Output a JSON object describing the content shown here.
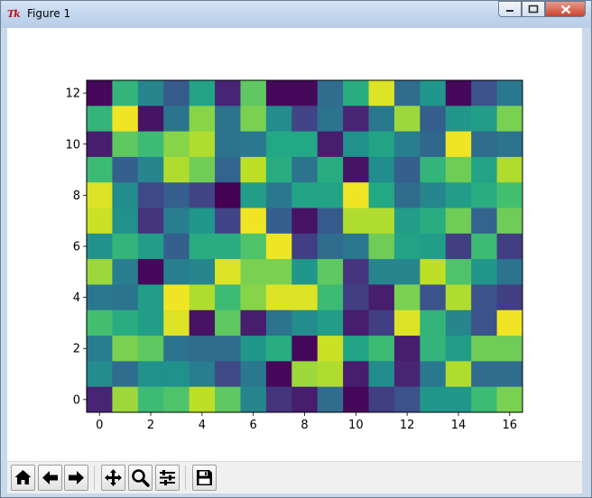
{
  "window": {
    "title": "Figure 1",
    "app_icon_text": "Tk",
    "controls": [
      "minimize",
      "maximize",
      "close"
    ]
  },
  "toolbar": {
    "buttons": [
      {
        "name": "home",
        "icon": "home-icon"
      },
      {
        "name": "back",
        "icon": "back-arrow-icon"
      },
      {
        "name": "forward",
        "icon": "forward-arrow-icon"
      },
      {
        "name": "pan",
        "icon": "move-icon"
      },
      {
        "name": "zoom",
        "icon": "zoom-icon"
      },
      {
        "name": "configure-subplots",
        "icon": "sliders-icon"
      },
      {
        "name": "save",
        "icon": "floppy-disk-icon"
      }
    ]
  },
  "chart_data": {
    "type": "heatmap",
    "colormap": "viridis",
    "value_range": [
      0,
      1
    ],
    "xlim": [
      -0.5,
      16.5
    ],
    "ylim": [
      12.5,
      -0.5
    ],
    "y_inverted": true,
    "x_ticks": [
      0,
      2,
      4,
      6,
      8,
      10,
      12,
      14,
      16
    ],
    "y_ticks": [
      0,
      2,
      4,
      6,
      8,
      10,
      12
    ],
    "grid": false,
    "values": [
      [
        0.02,
        0.65,
        0.45,
        0.28,
        0.58,
        0.1,
        0.75,
        0.02,
        0.02,
        0.35,
        0.62,
        0.95,
        0.35,
        0.52,
        0.02,
        0.25,
        0.4
      ],
      [
        0.65,
        0.98,
        0.05,
        0.38,
        0.82,
        0.38,
        0.8,
        0.48,
        0.2,
        0.38,
        0.1,
        0.4,
        0.85,
        0.3,
        0.52,
        0.55,
        0.8
      ],
      [
        0.08,
        0.75,
        0.68,
        0.82,
        0.88,
        0.38,
        0.4,
        0.6,
        0.6,
        0.08,
        0.5,
        0.58,
        0.42,
        0.33,
        0.98,
        0.35,
        0.38
      ],
      [
        0.68,
        0.3,
        0.45,
        0.88,
        0.78,
        0.32,
        0.9,
        0.62,
        0.38,
        0.62,
        0.05,
        0.48,
        0.3,
        0.65,
        0.78,
        0.58,
        0.88
      ],
      [
        0.95,
        0.48,
        0.22,
        0.3,
        0.2,
        0.0,
        0.55,
        0.4,
        0.58,
        0.58,
        0.98,
        0.6,
        0.35,
        0.45,
        0.55,
        0.62,
        0.7
      ],
      [
        0.92,
        0.5,
        0.15,
        0.42,
        0.52,
        0.2,
        0.98,
        0.3,
        0.05,
        0.28,
        0.88,
        0.88,
        0.55,
        0.62,
        0.78,
        0.32,
        0.78
      ],
      [
        0.5,
        0.65,
        0.55,
        0.3,
        0.62,
        0.62,
        0.72,
        0.98,
        0.18,
        0.35,
        0.4,
        0.78,
        0.58,
        0.55,
        0.18,
        0.68,
        0.18
      ],
      [
        0.85,
        0.42,
        0.02,
        0.42,
        0.45,
        0.95,
        0.8,
        0.8,
        0.52,
        0.75,
        0.15,
        0.45,
        0.45,
        0.9,
        0.72,
        0.52,
        0.38
      ],
      [
        0.4,
        0.38,
        0.55,
        0.98,
        0.88,
        0.68,
        0.82,
        0.95,
        0.95,
        0.68,
        0.18,
        0.08,
        0.8,
        0.25,
        0.88,
        0.25,
        0.18
      ],
      [
        0.7,
        0.62,
        0.55,
        0.95,
        0.05,
        0.75,
        0.08,
        0.38,
        0.48,
        0.55,
        0.08,
        0.18,
        0.95,
        0.65,
        0.45,
        0.25,
        0.98
      ],
      [
        0.42,
        0.8,
        0.75,
        0.38,
        0.35,
        0.35,
        0.52,
        0.62,
        0.02,
        0.92,
        0.58,
        0.68,
        0.08,
        0.65,
        0.55,
        0.78,
        0.78
      ],
      [
        0.48,
        0.35,
        0.5,
        0.5,
        0.42,
        0.22,
        0.4,
        0.02,
        0.85,
        0.88,
        0.08,
        0.48,
        0.1,
        0.4,
        0.88,
        0.35,
        0.35
      ],
      [
        0.1,
        0.85,
        0.68,
        0.72,
        0.9,
        0.75,
        0.45,
        0.15,
        0.08,
        0.35,
        0.02,
        0.18,
        0.25,
        0.52,
        0.52,
        0.68,
        0.8
      ]
    ]
  }
}
